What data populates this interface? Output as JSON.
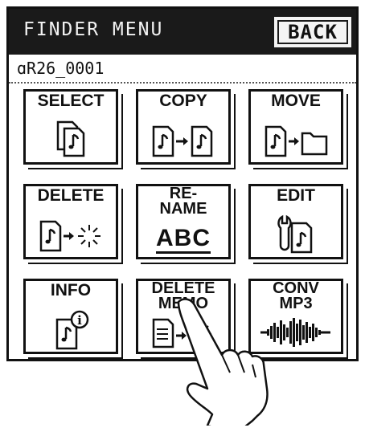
{
  "header": {
    "title": "FINDER MENU",
    "back_label": "BACK"
  },
  "file": {
    "name": "ɑR26_0001"
  },
  "menu": {
    "select": "SELECT",
    "copy": "COPY",
    "move": "MOVE",
    "delete": "DELETE",
    "rename_line1": "RE-",
    "rename_line2": "NAME",
    "rename_abc": "ABC",
    "edit": "EDIT",
    "info": "INFO",
    "delete_memo_line1": "DELETE",
    "delete_memo_line2": "MEMO",
    "conv_line1": "CONV",
    "conv_line2": "MP3"
  },
  "icons": {
    "select": "stacked-audio-files-icon",
    "copy": "file-copy-arrow-icon",
    "move": "file-to-folder-icon",
    "delete": "file-delete-burst-icon",
    "edit": "wrench-file-icon",
    "info": "file-info-icon",
    "delete_memo": "memo-delete-icon",
    "conv": "waveform-icon",
    "hand": "pointing-hand-icon"
  }
}
